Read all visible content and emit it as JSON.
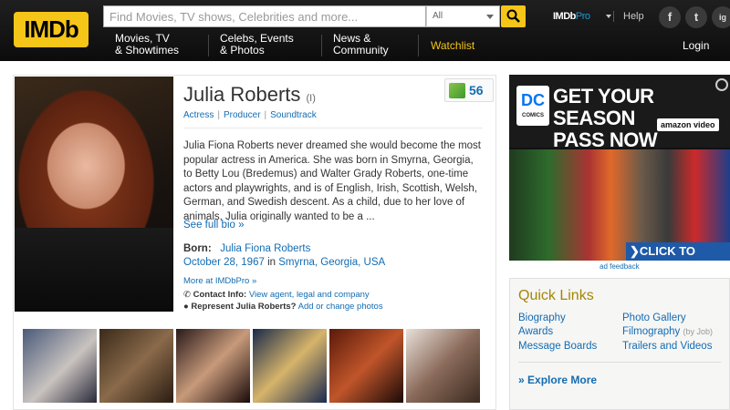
{
  "header": {
    "logo_text": "IMDb",
    "search_placeholder": "Find Movies, TV shows, Celebrities and more...",
    "search_category": "All",
    "nav": [
      {
        "line1": "Movies, TV",
        "line2": "& Showtimes"
      },
      {
        "line1": "Celebs, Events",
        "line2": "& Photos"
      },
      {
        "line1": "News &",
        "line2": "Community"
      }
    ],
    "watchlist": "Watchlist",
    "imdbpro_brand": "IMDb",
    "imdbpro_suffix": "Pro",
    "help": "Help",
    "social": [
      "f",
      "t",
      "ig"
    ],
    "login": "Login"
  },
  "profile": {
    "name": "Julia Roberts",
    "name_suffix": "(I)",
    "roles": [
      "Actress",
      "Producer",
      "Soundtrack"
    ],
    "starmeter": "56",
    "bio": "Julia Fiona Roberts never dreamed she would become the most popular actress in America. She was born in Smyrna, Georgia, to Betty Lou (Bredemus) and Walter Grady Roberts, one-time actors and playwrights, and is of English, Irish, Scottish, Welsh, German, and Swedish descent. As a child, due to her love of animals, Julia originally wanted to be a ...",
    "see_full_bio": "See full bio »",
    "born_label": "Born:",
    "born_name": "Julia Fiona Roberts",
    "born_date": "October 28, 1967",
    "born_in": "in",
    "born_place": "Smyrna, Georgia, USA",
    "more_pro": "More at IMDbPro »",
    "contact_label": "Contact Info:",
    "contact_link": "View agent, legal and company",
    "represent_label": "Represent Julia Roberts?",
    "represent_link": "Add or change photos"
  },
  "ad": {
    "brand": "DC",
    "brand_sub": "COMICS",
    "headline_1": "GET YOUR SEASON",
    "headline_2": "PASS NOW",
    "amazon": "amazon video",
    "cta": "❯CLICK TO EXPAND",
    "feedback": "ad feedback"
  },
  "quick_links": {
    "title": "Quick Links",
    "left": [
      "Biography",
      "Awards",
      "Message Boards"
    ],
    "right": [
      "Photo Gallery",
      "Filmography",
      "Trailers and Videos"
    ],
    "filmography_note": "(by Job)",
    "explore": "Explore More"
  },
  "colors": {
    "imdb_yellow": "#f5c518",
    "link_blue": "#136cb2",
    "quick_links_title": "#a58500"
  }
}
